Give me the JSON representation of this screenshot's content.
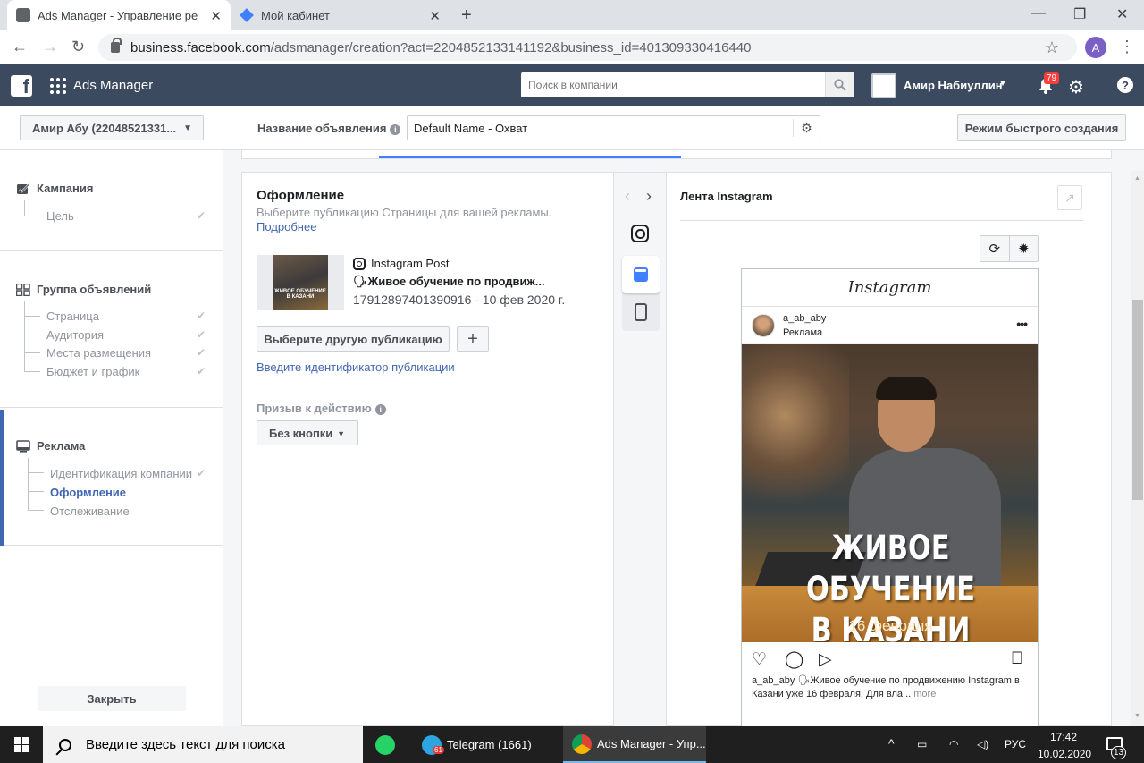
{
  "browser": {
    "tabs": [
      {
        "title": "Ads Manager - Управление рекл",
        "active": true
      },
      {
        "title": "Мой кабинет",
        "active": false
      }
    ],
    "url_host": "business.facebook.com",
    "url_path": "/adsmanager/creation?act=2204852133141192&business_id=401309330416440",
    "profile_initial": "A"
  },
  "fbbar": {
    "app_name": "Ads Manager",
    "search_placeholder": "Поиск в компании",
    "user_name": "Амир Набиуллин",
    "notifications": "79"
  },
  "header": {
    "account": "Амир Абу (22048521331...",
    "ad_name_label": "Название объявления",
    "ad_name_value": "Default Name - Охват",
    "quick_mode": "Режим быстрого создания"
  },
  "sidebar": {
    "campaign": {
      "label": "Кампания",
      "items": [
        "Цель"
      ]
    },
    "adset": {
      "label": "Группа объявлений",
      "items": [
        "Страница",
        "Аудитория",
        "Места размещения",
        "Бюджет и график"
      ]
    },
    "ad": {
      "label": "Реклама",
      "items": [
        "Идентификация компании",
        "Оформление",
        "Отслеживание"
      ],
      "active_item": "Оформление"
    },
    "close": "Закрыть"
  },
  "creative": {
    "title": "Оформление",
    "subtitle": "Выберите публикацию Страницы для вашей рекламы.",
    "more": "Подробнее",
    "post_type": "Instagram Post",
    "post_title": "🗣Живое обучение по продвиж...",
    "post_meta": "17912897401390916 - 10 фев 2020 г.",
    "choose_other": "Выберите другую публикацию",
    "enter_id": "Введите идентификатор публикации",
    "cta_label": "Призыв к действию",
    "cta_value": "Без кнопки"
  },
  "preview": {
    "title": "Лента Instagram",
    "ig_logo": "Instagram",
    "username": "a_ab_aby",
    "sponsored": "Реклама",
    "photo_line1": "ЖИВОЕ ОБУЧЕНИЕ",
    "photo_line2": "В КАЗАНИ",
    "photo_date": "16 февраля",
    "caption": "a_ab_aby 🗣Живое обучение по продвижению Instagram в Казани уже 16 февраля. Для вла...",
    "caption_more": "more"
  },
  "taskbar": {
    "search_placeholder": "Введите здесь текст для поиска",
    "telegram": "Telegram (1661)",
    "telegram_badge": "61",
    "chrome": "Ads Manager - Упр...",
    "lang": "РУС",
    "time": "17:42",
    "date": "10.02.2020",
    "notif_count": "13"
  }
}
